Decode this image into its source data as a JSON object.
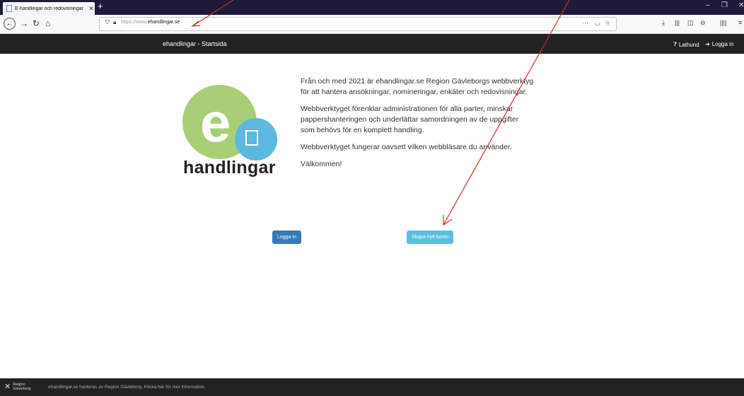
{
  "browser": {
    "tab_title": "E-handlingar och redovisningar",
    "tab_close": "✕",
    "new_tab": "+",
    "url_prefix": "https://www.",
    "url_domain": "ehandlingar.se",
    "url_more": "···"
  },
  "site": {
    "title": "ehandlingar - Startsida",
    "nav": {
      "help_label": "Lathund",
      "login_label": "Logga in"
    }
  },
  "logo": {
    "letter": "e",
    "word": "handlingar"
  },
  "intro": {
    "paragraphs": [
      "Från och med 2021 är ehandlingar.se Region Gävleborgs webbverktyg för att hantera ansökningar, nomineringar, enkäter och redovisningar.",
      "Webbverktyget förenklar administrationen för alla parter, minskar pappershanteringen och underlättar samordningen av de uppgifter som behövs för en komplett handling.",
      "Webbverktyget fungerar oavsett vilken webbläsare du använder.",
      "Välkommen!"
    ]
  },
  "buttons": {
    "login": "Logga in",
    "create_account": "Skapa nytt konto"
  },
  "footer": {
    "org_line1": "Region",
    "org_line2": "Gävleborg",
    "text": "ehandlingar.se hanteras av Region Gävleborg. Klicka här för mer information."
  },
  "colors": {
    "header_bg": "#222222",
    "primary_button": "#337ab7",
    "info_button": "#5bc0de",
    "logo_green": "#a8cf76",
    "logo_blue": "#5cb8e0",
    "annotation": "#d42a2a"
  }
}
